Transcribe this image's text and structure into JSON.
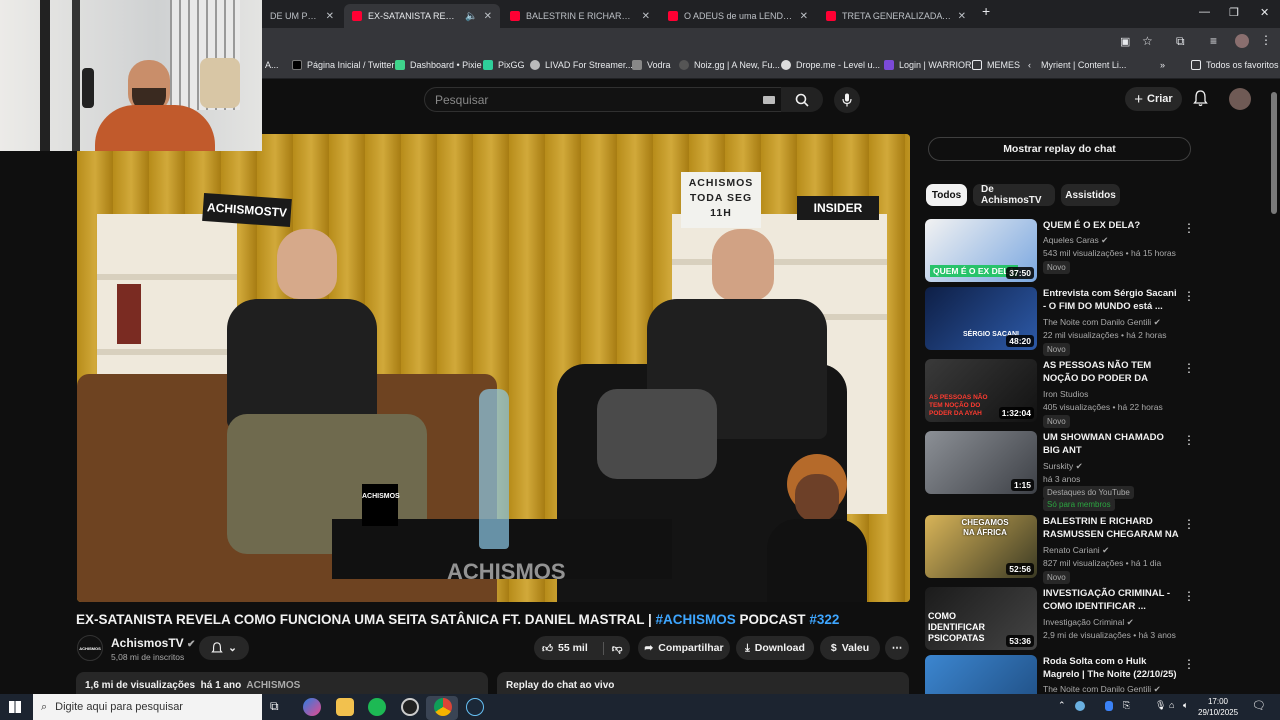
{
  "browser": {
    "tabs": [
      {
        "label": "DE UM PUNK"
      },
      {
        "label": "EX-SATANISTA REVELA COMO"
      },
      {
        "label": "BALESTRIN E RICHARD RASMUSSEN"
      },
      {
        "label": "O ADEUS de uma LENDA... o fim"
      },
      {
        "label": "TRETA GENERALIZADA CONTRA"
      }
    ],
    "new_tab": "+",
    "bookmarks": [
      {
        "label": "A..."
      },
      {
        "label": "Página Inicial / Twitter"
      },
      {
        "label": "Dashboard • Pixie"
      },
      {
        "label": "PixGG"
      },
      {
        "label": "LIVAD For Streamer..."
      },
      {
        "label": "Vodra"
      },
      {
        "label": "Noiz.gg | A New, Fu..."
      },
      {
        "label": "Drope.me - Level u..."
      },
      {
        "label": "Login | WARRIOR"
      },
      {
        "label": "MEMES"
      },
      {
        "label": "Myrient | Content Li..."
      }
    ],
    "all_favorites": "Todos os favoritos"
  },
  "header": {
    "search_placeholder": "Pesquisar",
    "create_label": "Criar"
  },
  "video": {
    "title_main": "EX-SATANISTA REVELA COMO FUNCIONA UMA SEITA SATÂNICA FT. DANIEL MASTRAL | ",
    "title_tag1": "#ACHISMOS",
    "title_mid": " PODCAST ",
    "title_tag2": "#322",
    "sign1": "ACHISMOSTV",
    "sign2": "ACHISMOS TODA SEG 11H",
    "sign3": "INSIDER",
    "watermark": "ACHISMOS",
    "mug_text": "ACHISMOS"
  },
  "channel": {
    "name": "AchismosTV",
    "subs": "5,08 mi de inscritos",
    "avatar_text": "ACHISMOS"
  },
  "actions": {
    "likes": "55 mil",
    "share": "Compartilhar",
    "download": "Download",
    "thanks": "Valeu",
    "more": "⋯"
  },
  "description": {
    "views": "1,6 mi de visualizações",
    "age": "há 1 ano",
    "tag": "ACHISMOS"
  },
  "chat": {
    "replay_button": "Mostrar replay do chat",
    "panel_title": "Replay do chat ao vivo"
  },
  "filters": [
    "Todos",
    "De AchismosTV",
    "Assistidos"
  ],
  "recommendations": [
    {
      "title": "QUEM É O EX DELA?",
      "channel": "Aqueles Caras",
      "meta": "543 mil visualizações • há 15 horas",
      "badge": "Novo",
      "duration": "37:50",
      "thumb_text": "QUEM É O EX DELA",
      "thumb_color": "#5b8fd6"
    },
    {
      "title": "Entrevista com Sérgio Sacani - O FIM DO MUNDO está ...",
      "channel": "The Noite com Danilo Gentili",
      "meta": "22 mil visualizações • há 2 horas",
      "badge": "Novo",
      "duration": "48:20",
      "thumb_text": "SÉRGIO SACANI",
      "thumb_color": "#1d3b7a"
    },
    {
      "title": "AS PESSOAS NÃO TEM NOÇÃO DO PODER DA AYAHUASCA | ...",
      "channel": "Iron Studios",
      "meta": "405 visualizações • há 22 horas",
      "badge": "Novo",
      "duration": "1:32:04",
      "thumb_text": "AS PESSOAS NÃO TEM NOÇÃO DO PODER DA AYAH",
      "thumb_color": "#2a2a2a"
    },
    {
      "title": "UM SHOWMAN CHAMADO BIG ANT",
      "channel": "Surskity",
      "meta": "há 3 anos",
      "badge": "Destaques do YouTube",
      "badge2": "Só para membros",
      "duration": "1:15",
      "thumb_text": "",
      "thumb_color": "#6a6f75"
    },
    {
      "title": "BALESTRIN E RICHARD RASMUSSEN CHEGARAM NA ...",
      "channel": "Renato Cariani",
      "meta": "827 mil visualizações • há 1 dia",
      "badge": "Novo",
      "duration": "52:56",
      "thumb_text": "CHEGAMOS NA ÁFRICA",
      "thumb_color": "#6b5a2e"
    },
    {
      "title": "INVESTIGAÇÃO CRIMINAL - COMO IDENTIFICAR ...",
      "channel": "Investigação Criminal",
      "meta": "2,9 mi de visualizações • há 3 anos",
      "badge": "",
      "duration": "53:36",
      "thumb_text": "COMO IDENTIFICAR PSICOPATAS",
      "thumb_color": "#1a1a1a"
    },
    {
      "title": "Roda Solta com o Hulk Magrelo | The Noite (22/10/25)",
      "channel": "The Noite com Danilo Gentili",
      "meta": "",
      "badge": "",
      "duration": "",
      "thumb_text": "",
      "thumb_color": "#2f6fb0"
    }
  ],
  "taskbar": {
    "search_placeholder": "Digite aqui para pesquisar",
    "time": "17:00",
    "date": "29/10/2025"
  },
  "colors": {
    "yt_red": "#ff0033",
    "link_blue": "#3ea6ff",
    "bg": "#0f0f0f"
  }
}
